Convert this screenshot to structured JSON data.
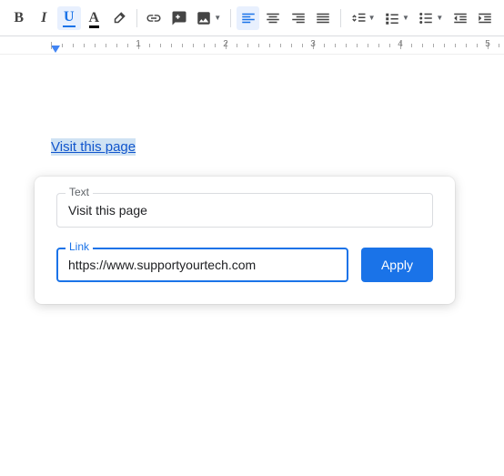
{
  "toolbar": {
    "bold": "B",
    "italic": "I",
    "underline": "U",
    "text_color": "A"
  },
  "ruler": {
    "marks": [
      1,
      2,
      3,
      4,
      5
    ]
  },
  "document": {
    "link_text": "Visit this page"
  },
  "link_dialog": {
    "text_label": "Text",
    "text_value": "Visit this page",
    "link_label": "Link",
    "link_value": "https://www.supportyourtech.com",
    "apply_label": "Apply"
  }
}
